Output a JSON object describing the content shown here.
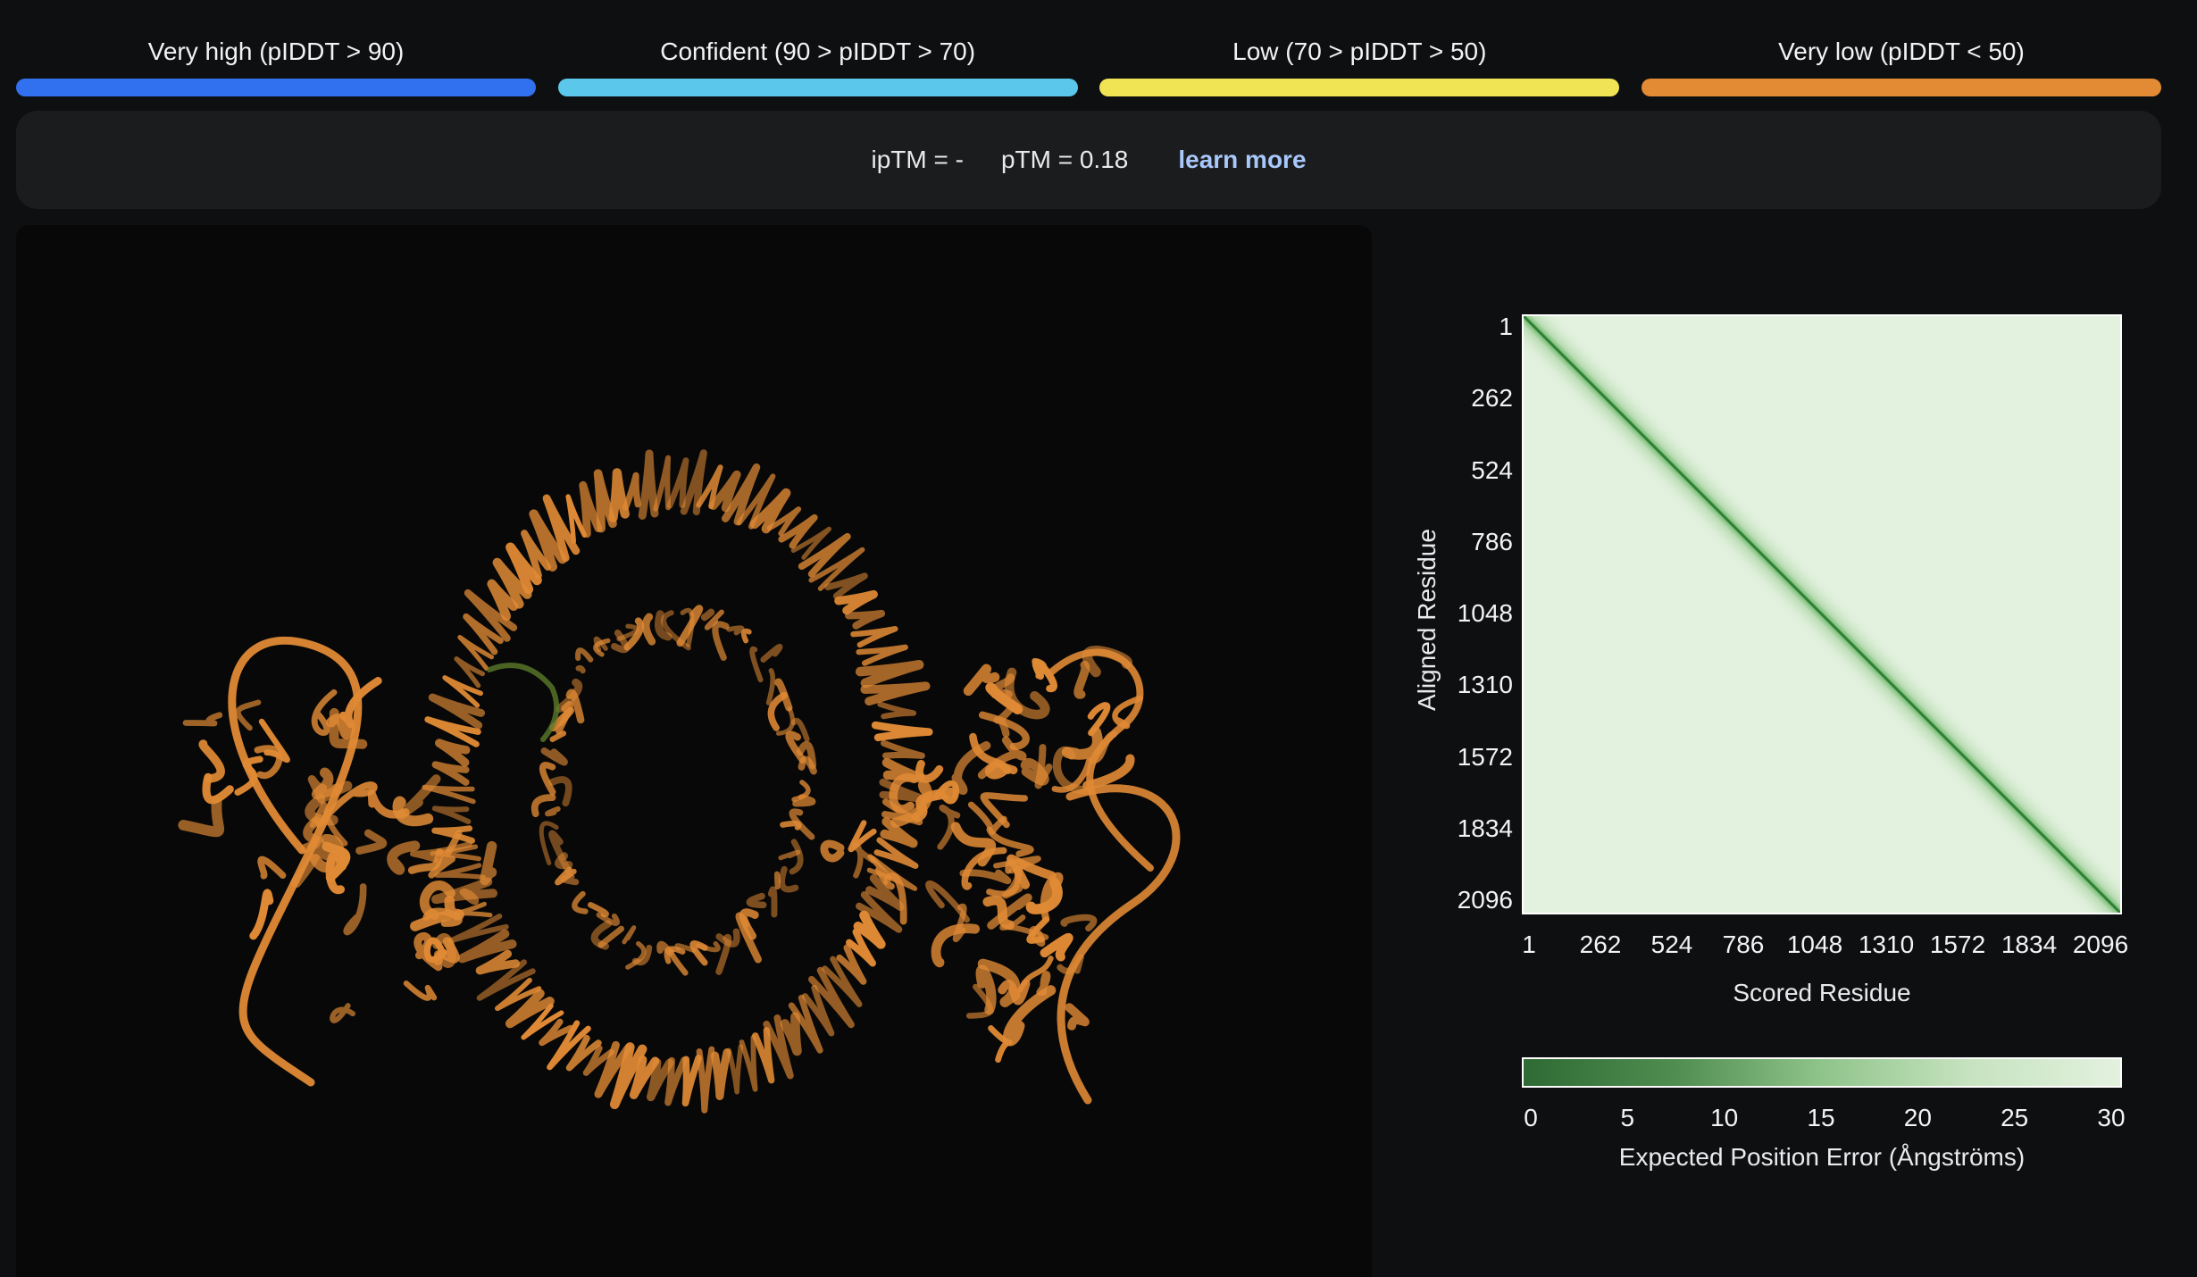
{
  "legend": {
    "items": [
      {
        "label": "Very high (pIDDT > 90)",
        "color": "#3171f0"
      },
      {
        "label": "Confident (90 > pIDDT > 70)",
        "color": "#5bc7ea"
      },
      {
        "label": "Low (70 > pIDDT > 50)",
        "color": "#f0e454"
      },
      {
        "label": "Very low (pIDDT < 50)",
        "color": "#e38a35"
      }
    ]
  },
  "scores": {
    "iptm": "ipTM = -",
    "ptm": "pTM = 0.18",
    "learn_more": "learn more"
  },
  "viewer": {
    "ribbon_color": "#e08a35",
    "highlight_color": "#5b7a2a"
  },
  "chart_data": {
    "type": "heatmap",
    "xlabel": "Scored Residue",
    "ylabel": "Aligned Residue",
    "x_ticks": [
      "1",
      "262",
      "524",
      "786",
      "1048",
      "1310",
      "1572",
      "1834",
      "2096"
    ],
    "y_ticks": [
      "1",
      "262",
      "524",
      "786",
      "1048",
      "1310",
      "1572",
      "1834",
      "2096"
    ],
    "residue_range": [
      1,
      2096
    ],
    "diagonal_error": 0,
    "off_diagonal_error": 30,
    "colorbar": {
      "label": "Expected Position Error (Ångströms)",
      "ticks": [
        "0",
        "5",
        "10",
        "15",
        "20",
        "25",
        "30"
      ],
      "range": [
        0,
        30
      ],
      "color_low": "#2e6b34",
      "color_high": "#e3f1df"
    }
  }
}
